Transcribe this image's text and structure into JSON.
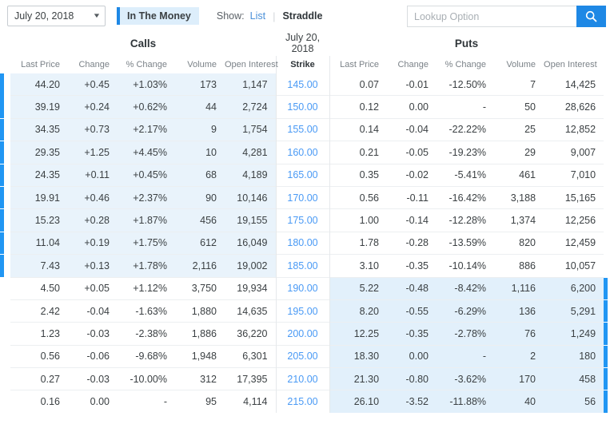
{
  "toolbar": {
    "expiration_date": "July 20, 2018",
    "caret_icon": "chevron-down-icon",
    "in_the_money_label": "In The Money",
    "show_label": "Show:",
    "show_list_label": "List",
    "show_separator": "|",
    "show_straddle_label": "Straddle",
    "lookup_placeholder": "Lookup Option",
    "lookup_value": "",
    "search_icon": "search-icon"
  },
  "colors": {
    "accent": "#1e88e5",
    "itm_bar": "#2196f3",
    "itm_call_bg": "#e9f3fb",
    "itm_put_bg": "#e2f0fb",
    "up": "#3aab6b",
    "down": "#f2636a",
    "strike_link": "#4a9af5",
    "chip_bg": "#ddeefb"
  },
  "table": {
    "group_calls": "Calls",
    "group_date": "July 20, 2018",
    "group_puts": "Puts",
    "headers": {
      "last_price": "Last Price",
      "change": "Change",
      "pct_change": "% Change",
      "volume": "Volume",
      "open_interest": "Open Interest",
      "strike": "Strike"
    },
    "rows": [
      {
        "strike": "145.00",
        "call_itm": true,
        "put_itm": false,
        "call": {
          "last": "44.20",
          "chg": "+0.45",
          "chg_dir": "up",
          "pct": "+1.03%",
          "pct_dir": "up",
          "vol": "173",
          "oi": "1,147"
        },
        "put": {
          "last": "0.07",
          "chg": "-0.01",
          "chg_dir": "down",
          "pct": "-12.50%",
          "pct_dir": "down",
          "vol": "7",
          "oi": "14,425"
        }
      },
      {
        "strike": "150.00",
        "call_itm": true,
        "put_itm": false,
        "call": {
          "last": "39.19",
          "chg": "+0.24",
          "chg_dir": "up",
          "pct": "+0.62%",
          "pct_dir": "up",
          "vol": "44",
          "oi": "2,724"
        },
        "put": {
          "last": "0.12",
          "chg": "0.00",
          "chg_dir": "flat",
          "pct": "-",
          "pct_dir": "dash",
          "vol": "50",
          "oi": "28,626"
        }
      },
      {
        "strike": "155.00",
        "call_itm": true,
        "put_itm": false,
        "call": {
          "last": "34.35",
          "chg": "+0.73",
          "chg_dir": "up",
          "pct": "+2.17%",
          "pct_dir": "up",
          "vol": "9",
          "oi": "1,754"
        },
        "put": {
          "last": "0.14",
          "chg": "-0.04",
          "chg_dir": "down",
          "pct": "-22.22%",
          "pct_dir": "down",
          "vol": "25",
          "oi": "12,852"
        }
      },
      {
        "strike": "160.00",
        "call_itm": true,
        "put_itm": false,
        "call": {
          "last": "29.35",
          "chg": "+1.25",
          "chg_dir": "up",
          "pct": "+4.45%",
          "pct_dir": "up",
          "vol": "10",
          "oi": "4,281"
        },
        "put": {
          "last": "0.21",
          "chg": "-0.05",
          "chg_dir": "down",
          "pct": "-19.23%",
          "pct_dir": "down",
          "vol": "29",
          "oi": "9,007"
        }
      },
      {
        "strike": "165.00",
        "call_itm": true,
        "put_itm": false,
        "call": {
          "last": "24.35",
          "chg": "+0.11",
          "chg_dir": "up",
          "pct": "+0.45%",
          "pct_dir": "up",
          "vol": "68",
          "oi": "4,189"
        },
        "put": {
          "last": "0.35",
          "chg": "-0.02",
          "chg_dir": "down",
          "pct": "-5.41%",
          "pct_dir": "down",
          "vol": "461",
          "oi": "7,010"
        }
      },
      {
        "strike": "170.00",
        "call_itm": true,
        "put_itm": false,
        "call": {
          "last": "19.91",
          "chg": "+0.46",
          "chg_dir": "up",
          "pct": "+2.37%",
          "pct_dir": "up",
          "vol": "90",
          "oi": "10,146"
        },
        "put": {
          "last": "0.56",
          "chg": "-0.11",
          "chg_dir": "down",
          "pct": "-16.42%",
          "pct_dir": "down",
          "vol": "3,188",
          "oi": "15,165"
        }
      },
      {
        "strike": "175.00",
        "call_itm": true,
        "put_itm": false,
        "call": {
          "last": "15.23",
          "chg": "+0.28",
          "chg_dir": "up",
          "pct": "+1.87%",
          "pct_dir": "up",
          "vol": "456",
          "oi": "19,155"
        },
        "put": {
          "last": "1.00",
          "chg": "-0.14",
          "chg_dir": "down",
          "pct": "-12.28%",
          "pct_dir": "down",
          "vol": "1,374",
          "oi": "12,256"
        }
      },
      {
        "strike": "180.00",
        "call_itm": true,
        "put_itm": false,
        "call": {
          "last": "11.04",
          "chg": "+0.19",
          "chg_dir": "up",
          "pct": "+1.75%",
          "pct_dir": "up",
          "vol": "612",
          "oi": "16,049"
        },
        "put": {
          "last": "1.78",
          "chg": "-0.28",
          "chg_dir": "down",
          "pct": "-13.59%",
          "pct_dir": "down",
          "vol": "820",
          "oi": "12,459"
        }
      },
      {
        "strike": "185.00",
        "call_itm": true,
        "put_itm": false,
        "call": {
          "last": "7.43",
          "chg": "+0.13",
          "chg_dir": "up",
          "pct": "+1.78%",
          "pct_dir": "up",
          "vol": "2,116",
          "oi": "19,002"
        },
        "put": {
          "last": "3.10",
          "chg": "-0.35",
          "chg_dir": "down",
          "pct": "-10.14%",
          "pct_dir": "down",
          "vol": "886",
          "oi": "10,057"
        }
      },
      {
        "strike": "190.00",
        "call_itm": false,
        "put_itm": true,
        "call": {
          "last": "4.50",
          "chg": "+0.05",
          "chg_dir": "up",
          "pct": "+1.12%",
          "pct_dir": "up",
          "vol": "3,750",
          "oi": "19,934"
        },
        "put": {
          "last": "5.22",
          "chg": "-0.48",
          "chg_dir": "down",
          "pct": "-8.42%",
          "pct_dir": "down",
          "vol": "1,116",
          "oi": "6,200"
        }
      },
      {
        "strike": "195.00",
        "call_itm": false,
        "put_itm": true,
        "call": {
          "last": "2.42",
          "chg": "-0.04",
          "chg_dir": "down",
          "pct": "-1.63%",
          "pct_dir": "down",
          "vol": "1,880",
          "oi": "14,635"
        },
        "put": {
          "last": "8.20",
          "chg": "-0.55",
          "chg_dir": "down",
          "pct": "-6.29%",
          "pct_dir": "down",
          "vol": "136",
          "oi": "5,291"
        }
      },
      {
        "strike": "200.00",
        "call_itm": false,
        "put_itm": true,
        "call": {
          "last": "1.23",
          "chg": "-0.03",
          "chg_dir": "down",
          "pct": "-2.38%",
          "pct_dir": "down",
          "vol": "1,886",
          "oi": "36,220"
        },
        "put": {
          "last": "12.25",
          "chg": "-0.35",
          "chg_dir": "down",
          "pct": "-2.78%",
          "pct_dir": "down",
          "vol": "76",
          "oi": "1,249"
        }
      },
      {
        "strike": "205.00",
        "call_itm": false,
        "put_itm": true,
        "call": {
          "last": "0.56",
          "chg": "-0.06",
          "chg_dir": "down",
          "pct": "-9.68%",
          "pct_dir": "down",
          "vol": "1,948",
          "oi": "6,301"
        },
        "put": {
          "last": "18.30",
          "chg": "0.00",
          "chg_dir": "flat",
          "pct": "-",
          "pct_dir": "dash",
          "vol": "2",
          "oi": "180"
        }
      },
      {
        "strike": "210.00",
        "call_itm": false,
        "put_itm": true,
        "call": {
          "last": "0.27",
          "chg": "-0.03",
          "chg_dir": "down",
          "pct": "-10.00%",
          "pct_dir": "down",
          "vol": "312",
          "oi": "17,395"
        },
        "put": {
          "last": "21.30",
          "chg": "-0.80",
          "chg_dir": "down",
          "pct": "-3.62%",
          "pct_dir": "down",
          "vol": "170",
          "oi": "458"
        }
      },
      {
        "strike": "215.00",
        "call_itm": false,
        "put_itm": true,
        "call": {
          "last": "0.16",
          "chg": "0.00",
          "chg_dir": "flat",
          "pct": "-",
          "pct_dir": "dash",
          "vol": "95",
          "oi": "4,114"
        },
        "put": {
          "last": "26.10",
          "chg": "-3.52",
          "chg_dir": "down",
          "pct": "-11.88%",
          "pct_dir": "down",
          "vol": "40",
          "oi": "56"
        }
      }
    ]
  }
}
